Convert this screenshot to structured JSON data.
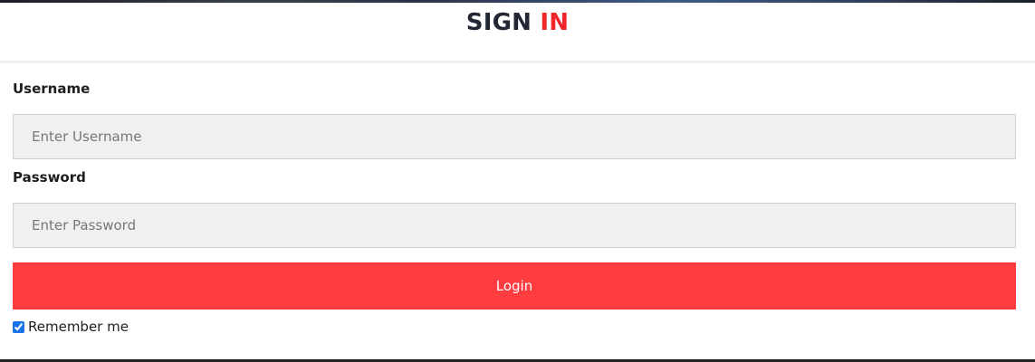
{
  "header": {
    "title_part1": "SIGN",
    "title_part2": "IN"
  },
  "form": {
    "username": {
      "label": "Username",
      "placeholder": "Enter Username",
      "value": ""
    },
    "password": {
      "label": "Password",
      "placeholder": "Enter Password",
      "value": ""
    },
    "login_label": "Login",
    "remember": {
      "label": "Remember me",
      "checked": true
    }
  },
  "colors": {
    "accent": "#ff3c40",
    "title_dark": "#222733",
    "title_red": "#f0262b",
    "input_bg": "#f0f0f0"
  }
}
